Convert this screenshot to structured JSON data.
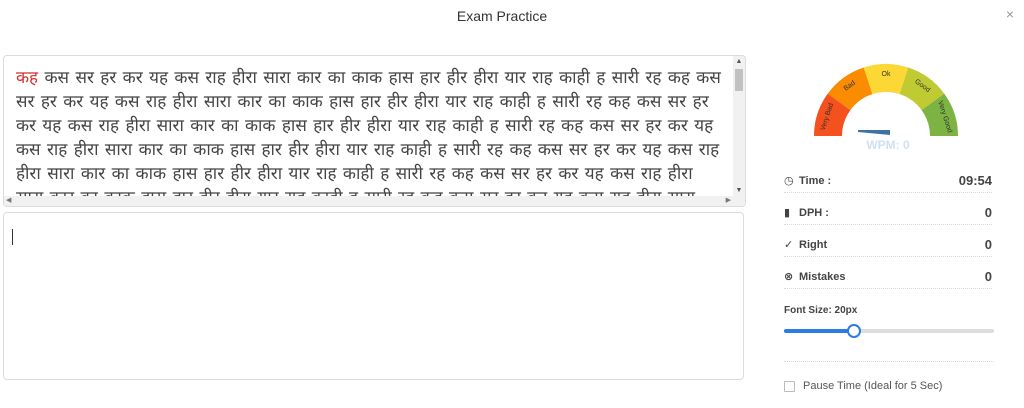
{
  "header": {
    "title": "Exam Practice",
    "close_label": "×"
  },
  "passage": {
    "current_word": "कह",
    "text": "कस सर हर कर यह कस राह हीरा सारा कार का काक हास हार हीर हीरा यार राह काही ह सारी रह कह कस सर हर कर यह कस राह हीरा सारा कार का काक हास हार हीर हीरा यार राह काही ह सारी रह कह कस सर हर कर यह कस राह हीरा सारा कार का काक हास हार हीर हीरा यार राह काही ह सारी रह कह कस सर हर कर यह कस राह हीरा सारा कार का काक हास हार हीर हीरा यार राह काही ह सारी रह कह कस सर हर कर यह कस राह हीरा सारा कार का काक हास हार हीर हीरा यार राह काही ह सारी रह कह कस सर हर कर यह कस राह हीरा सारा कार का काक हास हार हीर हीरा यार राह काही ह सारी रह कह कस सर हर कर यह कस राह हीरा सारा कार का काक हास हार"
  },
  "gauge": {
    "segments": [
      {
        "label": "Very Bad",
        "color": "#f4511e"
      },
      {
        "label": "Bad",
        "color": "#fb8c00"
      },
      {
        "label": "Ok",
        "color": "#fdd835"
      },
      {
        "label": "Good",
        "color": "#c0ca33"
      },
      {
        "label": "Very Good",
        "color": "#7cb342"
      }
    ],
    "needle_color": "#3e73a8",
    "wpm_text": "WPM: 0"
  },
  "stats": {
    "time": {
      "label": "Time :",
      "value": "09:54"
    },
    "dph": {
      "label": "DPH :",
      "value": "0"
    },
    "right": {
      "label": "Right",
      "value": "0"
    },
    "mistakes": {
      "label": "Mistakes",
      "value": "0"
    }
  },
  "font_size": {
    "label": "Font Size: 20px",
    "fraction": 0.33
  },
  "pause": {
    "label": "Pause Time (Ideal for 5 Sec)",
    "checked": false
  }
}
